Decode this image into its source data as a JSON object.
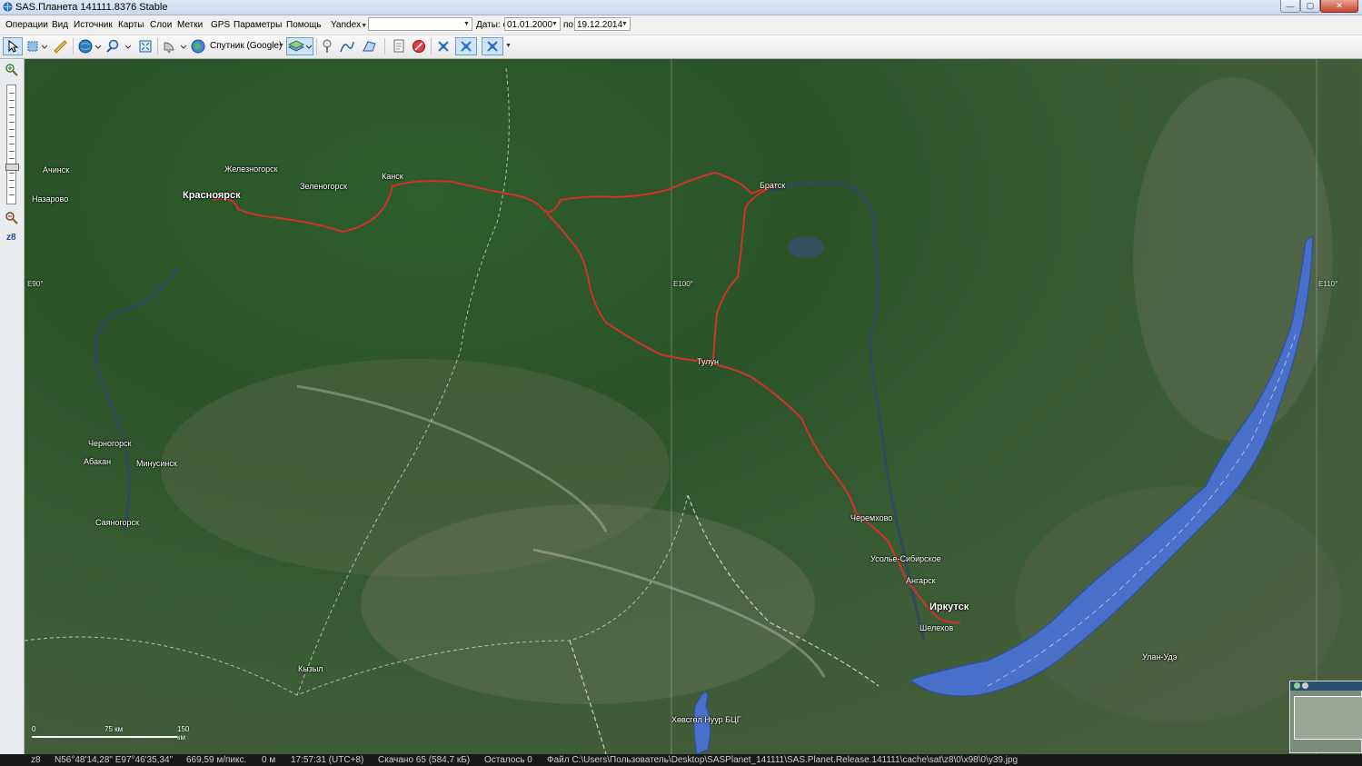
{
  "window": {
    "title": "SAS.Планета 141111.8376 Stable"
  },
  "menu": {
    "items": [
      "Операции",
      "Вид",
      "Источник",
      "Карты",
      "Слои",
      "Метки",
      "GPS",
      "Параметры",
      "Помощь"
    ],
    "search_provider": "Yandex",
    "search_value": "",
    "dates_label": "Даты: с",
    "date_from": "01.01.2000",
    "date_to_label": "по",
    "date_to": "19.12.2014"
  },
  "toolbar": {
    "map_source_label": "Спутник (Google)"
  },
  "zoom": {
    "level_label": "z8",
    "level": 8
  },
  "map": {
    "grid_labels": [
      "E90°",
      "E100°",
      "E110°"
    ],
    "cities": [
      {
        "name": "Ачинск",
        "major": false
      },
      {
        "name": "Железногорск",
        "major": false
      },
      {
        "name": "Назарово",
        "major": false
      },
      {
        "name": "Красноярск",
        "major": true
      },
      {
        "name": "Зеленогорск",
        "major": false
      },
      {
        "name": "Канск",
        "major": false
      },
      {
        "name": "Братск",
        "major": false
      },
      {
        "name": "Тулун",
        "major": false
      },
      {
        "name": "Черногорск",
        "major": false
      },
      {
        "name": "Абакан",
        "major": false
      },
      {
        "name": "Минусинск",
        "major": false
      },
      {
        "name": "Саяногорск",
        "major": false
      },
      {
        "name": "Черемхово",
        "major": false
      },
      {
        "name": "Усолье-Сибирское",
        "major": false
      },
      {
        "name": "Ангарск",
        "major": false
      },
      {
        "name": "Иркутск",
        "major": true
      },
      {
        "name": "Шелехов",
        "major": false
      },
      {
        "name": "Улан-Удэ",
        "major": false
      },
      {
        "name": "Кызыл",
        "major": false
      },
      {
        "name": "Хөвсгөл Нуур БЦГ",
        "major": false
      }
    ],
    "scale": {
      "zero": "0",
      "mid": "75 км",
      "end": "150 км"
    },
    "route_color": "#d2322a",
    "lake_color": "#4a6fc8"
  },
  "status": {
    "zoom": "z8",
    "coords": "N56°48'14,28\" E97°46'35,34\"",
    "resolution": "669,59 м/пикс.",
    "altitude": "0 м",
    "time": "17:57:31 (UTC+8)",
    "downloaded": "Скачано 65 (584,7 кБ)",
    "remaining": "Осталось 0",
    "file": "Файл C:\\Users\\Пользователь\\Desktop\\SASPlanet_141111\\SAS.Planet.Release.141111\\cache\\sat\\z8\\0\\x98\\0\\y39.jpg"
  }
}
